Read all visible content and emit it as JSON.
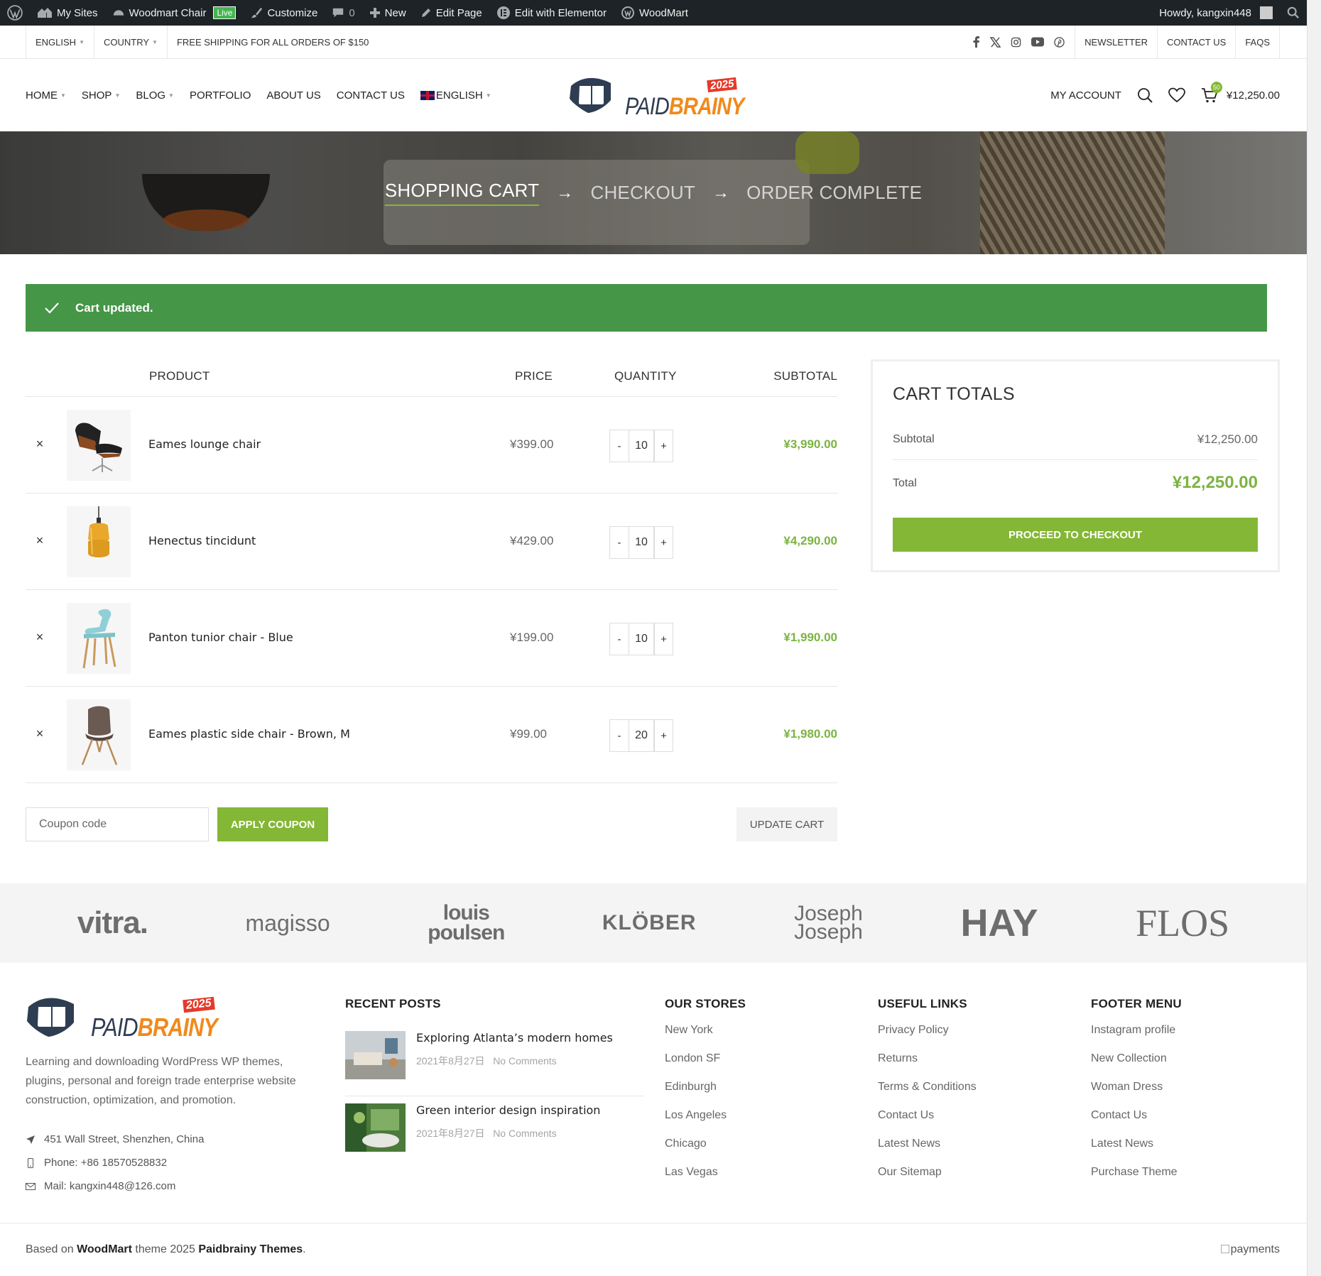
{
  "adminbar": {
    "my_sites": "My Sites",
    "site_name": "Woodmart Chair",
    "live": "Live",
    "customize": "Customize",
    "comments": "0",
    "new": "New",
    "edit_page": "Edit Page",
    "elementor": "Edit with Elementor",
    "woodmart": "WoodMart",
    "howdy": "Howdy, kangxin448"
  },
  "topbar": {
    "language": "ENGLISH",
    "country": "COUNTRY",
    "shipping": "FREE SHIPPING FOR ALL ORDERS OF $150",
    "newsletter": "NEWSLETTER",
    "contact": "CONTACT US",
    "faqs": "FAQS"
  },
  "nav": {
    "home": "HOME",
    "shop": "SHOP",
    "blog": "BLOG",
    "portfolio": "PORTFOLIO",
    "about": "ABOUT US",
    "contact": "CONTACT US",
    "language": "ENGLISH"
  },
  "logo": {
    "text_a": "PAID",
    "text_b": "BRAINY",
    "year": "2025"
  },
  "header_right": {
    "account": "MY ACCOUNT",
    "cart_count": "50",
    "cart_total": "¥12,250.00"
  },
  "steps": {
    "cart": "SHOPPING CART",
    "checkout": "CHECKOUT",
    "complete": "ORDER COMPLETE",
    "arrow": "→"
  },
  "notice": {
    "text": "Cart updated."
  },
  "table": {
    "headers": {
      "product": "PRODUCT",
      "price": "PRICE",
      "quantity": "QUANTITY",
      "subtotal": "SUBTOTAL"
    },
    "rows": [
      {
        "name": "Eames lounge chair",
        "price": "¥399.00",
        "qty": "10",
        "subtotal": "¥3,990.00"
      },
      {
        "name": "Henectus tincidunt",
        "price": "¥429.00",
        "qty": "10",
        "subtotal": "¥4,290.00"
      },
      {
        "name": "Panton tunior chair - Blue",
        "price": "¥199.00",
        "qty": "10",
        "subtotal": "¥1,990.00"
      },
      {
        "name": "Eames plastic side chair - Brown, M",
        "price": "¥99.00",
        "qty": "20",
        "subtotal": "¥1,980.00"
      }
    ],
    "remove": "×",
    "minus": "-",
    "plus": "+"
  },
  "actions": {
    "coupon_placeholder": "Coupon code",
    "apply": "APPLY COUPON",
    "update": "UPDATE CART"
  },
  "totals": {
    "title": "CART TOTALS",
    "subtotal_label": "Subtotal",
    "subtotal_value": "¥12,250.00",
    "total_label": "Total",
    "total_value": "¥12,250.00",
    "checkout": "PROCEED TO CHECKOUT"
  },
  "brands": {
    "vitra": "vitra.",
    "magisso": "magisso",
    "louis_1": "louis",
    "louis_2": "poulsen",
    "klober": "KLÖBER",
    "joseph_1": "Joseph",
    "joseph_2": "Joseph",
    "hay": "HAY",
    "flos": "FLOS"
  },
  "footer": {
    "about": "Learning and downloading WordPress WP themes, plugins, personal and foreign trade enterprise website construction, optimization, and promotion.",
    "address": "451 Wall Street, Shenzhen, China",
    "phone": "Phone: +86 18570528832",
    "mail": "Mail: kangxin448@126.com",
    "recent_title": "RECENT POSTS",
    "posts": [
      {
        "title": "Exploring Atlanta’s modern homes",
        "date": "2021年8月27日",
        "comments": "No Comments"
      },
      {
        "title": "Green interior design inspiration",
        "date": "2021年8月27日",
        "comments": "No Comments"
      }
    ],
    "stores_title": "OUR STORES",
    "stores": [
      "New York",
      "London SF",
      "Edinburgh",
      "Los Angeles",
      "Chicago",
      "Las Vegas"
    ],
    "useful_title": "USEFUL LINKS",
    "useful": [
      "Privacy Policy",
      "Returns",
      "Terms & Conditions",
      "Contact Us",
      "Latest News",
      "Our Sitemap"
    ],
    "menu_title": "FOOTER MENU",
    "menu": [
      "Instagram profile",
      "New Collection",
      "Woman Dress",
      "Contact Us",
      "Latest News",
      "Purchase Theme"
    ]
  },
  "copyright": {
    "based_on": "Based on ",
    "woodmart": "WoodMart",
    "theme": " theme 2025 ",
    "themes": "Paidbrainy Themes",
    "dot": ".",
    "payments": "payments"
  },
  "colors": {
    "accent": "#83b735",
    "notice": "#459647",
    "admin": "#1d2327"
  }
}
